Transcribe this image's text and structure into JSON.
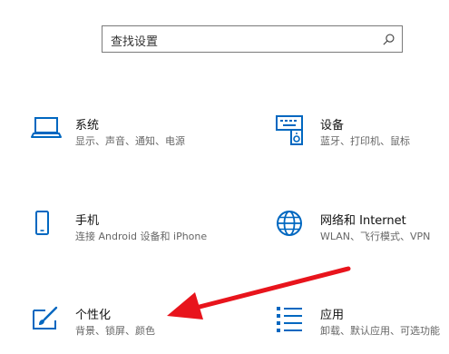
{
  "search": {
    "placeholder": "查找设置",
    "icon": "search-icon"
  },
  "tiles": [
    {
      "title": "系统",
      "subtitle": "显示、声音、通知、电源",
      "icon": "laptop-icon"
    },
    {
      "title": "设备",
      "subtitle": "蓝牙、打印机、鼠标",
      "icon": "keyboard-speaker-icon"
    },
    {
      "title": "手机",
      "subtitle": "连接 Android 设备和 iPhone",
      "icon": "phone-icon"
    },
    {
      "title": "网络和 Internet",
      "subtitle": "WLAN、飞行模式、VPN",
      "icon": "globe-icon"
    },
    {
      "title": "个性化",
      "subtitle": "背景、锁屏、颜色",
      "icon": "paint-brush-icon"
    },
    {
      "title": "应用",
      "subtitle": "卸载、默认应用、可选功能",
      "icon": "apps-list-icon"
    }
  ],
  "colors": {
    "accent": "#0067c0",
    "annotation_arrow": "#e8141c"
  }
}
